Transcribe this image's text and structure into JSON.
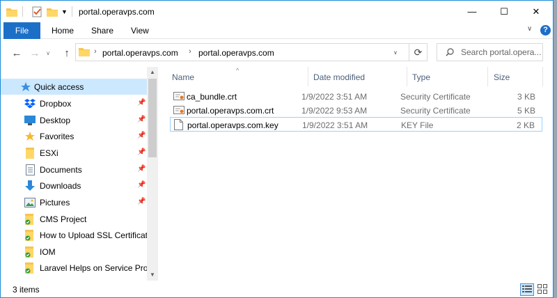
{
  "window": {
    "title": "portal.operavps.com",
    "controls": {
      "minimize": "—",
      "maximize": "☐",
      "close": "✕"
    }
  },
  "ribbon": {
    "tabs": [
      "File",
      "Home",
      "Share",
      "View"
    ],
    "help_label": "?"
  },
  "navigation": {
    "breadcrumbs": [
      "portal.operavps.com",
      "portal.operavps.com"
    ],
    "search_placeholder": "Search portal.opera..."
  },
  "sidebar": {
    "items": [
      {
        "label": "Quick access",
        "icon": "star-icon",
        "pinned": false,
        "selected": true
      },
      {
        "label": "Dropbox",
        "icon": "dropbox-icon",
        "pinned": true
      },
      {
        "label": "Desktop",
        "icon": "desktop-icon",
        "pinned": true
      },
      {
        "label": "Favorites",
        "icon": "star-icon",
        "pinned": true
      },
      {
        "label": "ESXi",
        "icon": "folder-icon",
        "pinned": true
      },
      {
        "label": "Documents",
        "icon": "documents-icon",
        "pinned": true
      },
      {
        "label": "Downloads",
        "icon": "downloads-icon",
        "pinned": true
      },
      {
        "label": "Pictures",
        "icon": "pictures-icon",
        "pinned": true
      },
      {
        "label": "CMS Project",
        "icon": "synced-folder-icon",
        "pinned": false
      },
      {
        "label": "How to Upload SSL Certificate",
        "icon": "synced-folder-icon",
        "pinned": false
      },
      {
        "label": "IOM",
        "icon": "synced-folder-icon",
        "pinned": false
      },
      {
        "label": "Laravel Helps on Service Provi",
        "icon": "synced-folder-icon",
        "pinned": false
      }
    ]
  },
  "file_list": {
    "columns": {
      "name": "Name",
      "date": "Date modified",
      "type": "Type",
      "size": "Size"
    },
    "rows": [
      {
        "name": "ca_bundle.crt",
        "date": "1/9/2022 3:51 AM",
        "type": "Security Certificate",
        "size": "3 KB",
        "icon": "certificate-icon"
      },
      {
        "name": "portal.operavps.com.crt",
        "date": "1/9/2022 9:53 AM",
        "type": "Security Certificate",
        "size": "5 KB",
        "icon": "certificate-icon"
      },
      {
        "name": "portal.operavps.com.key",
        "date": "1/9/2022 3:51 AM",
        "type": "KEY File",
        "size": "2 KB",
        "icon": "file-icon"
      }
    ]
  },
  "status": {
    "item_count": "3 items"
  },
  "colors": {
    "accent": "#1c6fc7",
    "selection": "#cce8ff",
    "folder": "#f6c54f",
    "header_text": "#4c607a"
  }
}
